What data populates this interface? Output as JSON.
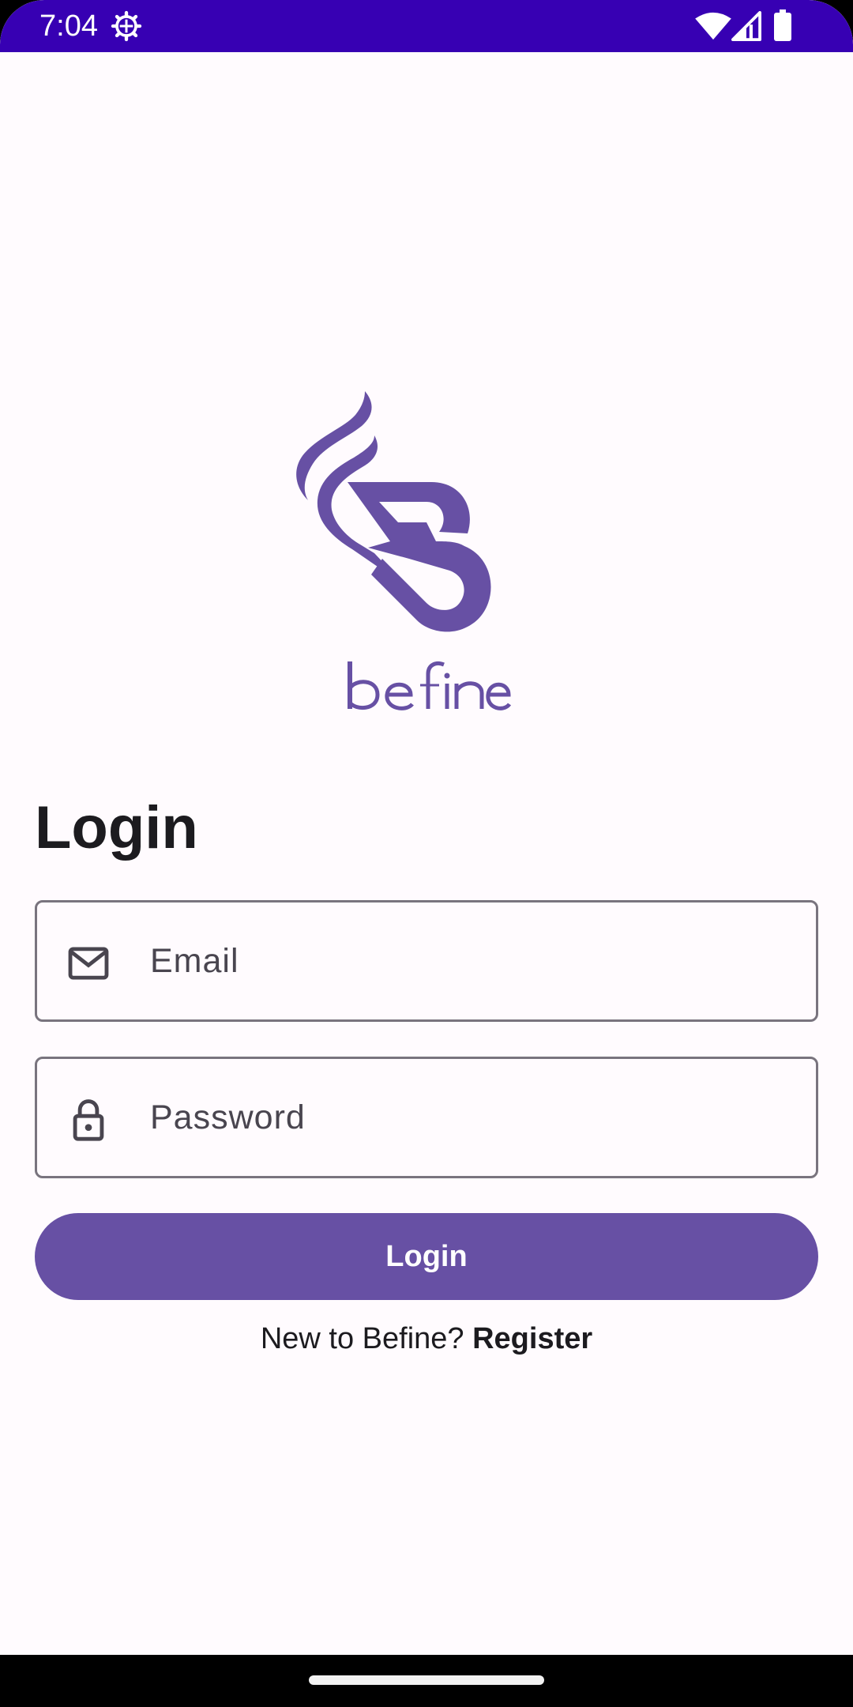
{
  "status_bar": {
    "time": "7:04",
    "bg_color": "#3700b3",
    "icons": [
      "settings-gear-icon",
      "wifi-icon",
      "cell-signal-icon",
      "battery-icon"
    ]
  },
  "brand": {
    "name": "befine",
    "color": "#6750a4"
  },
  "login": {
    "title": "Login",
    "email_placeholder": "Email",
    "password_placeholder": "Password",
    "button_label": "Login",
    "register_prompt": "New to Befine? ",
    "register_link": "Register"
  },
  "colors": {
    "accent": "#6750a4",
    "field_border": "#79747e",
    "background": "#fffbfe",
    "text": "#1c1b1f"
  }
}
